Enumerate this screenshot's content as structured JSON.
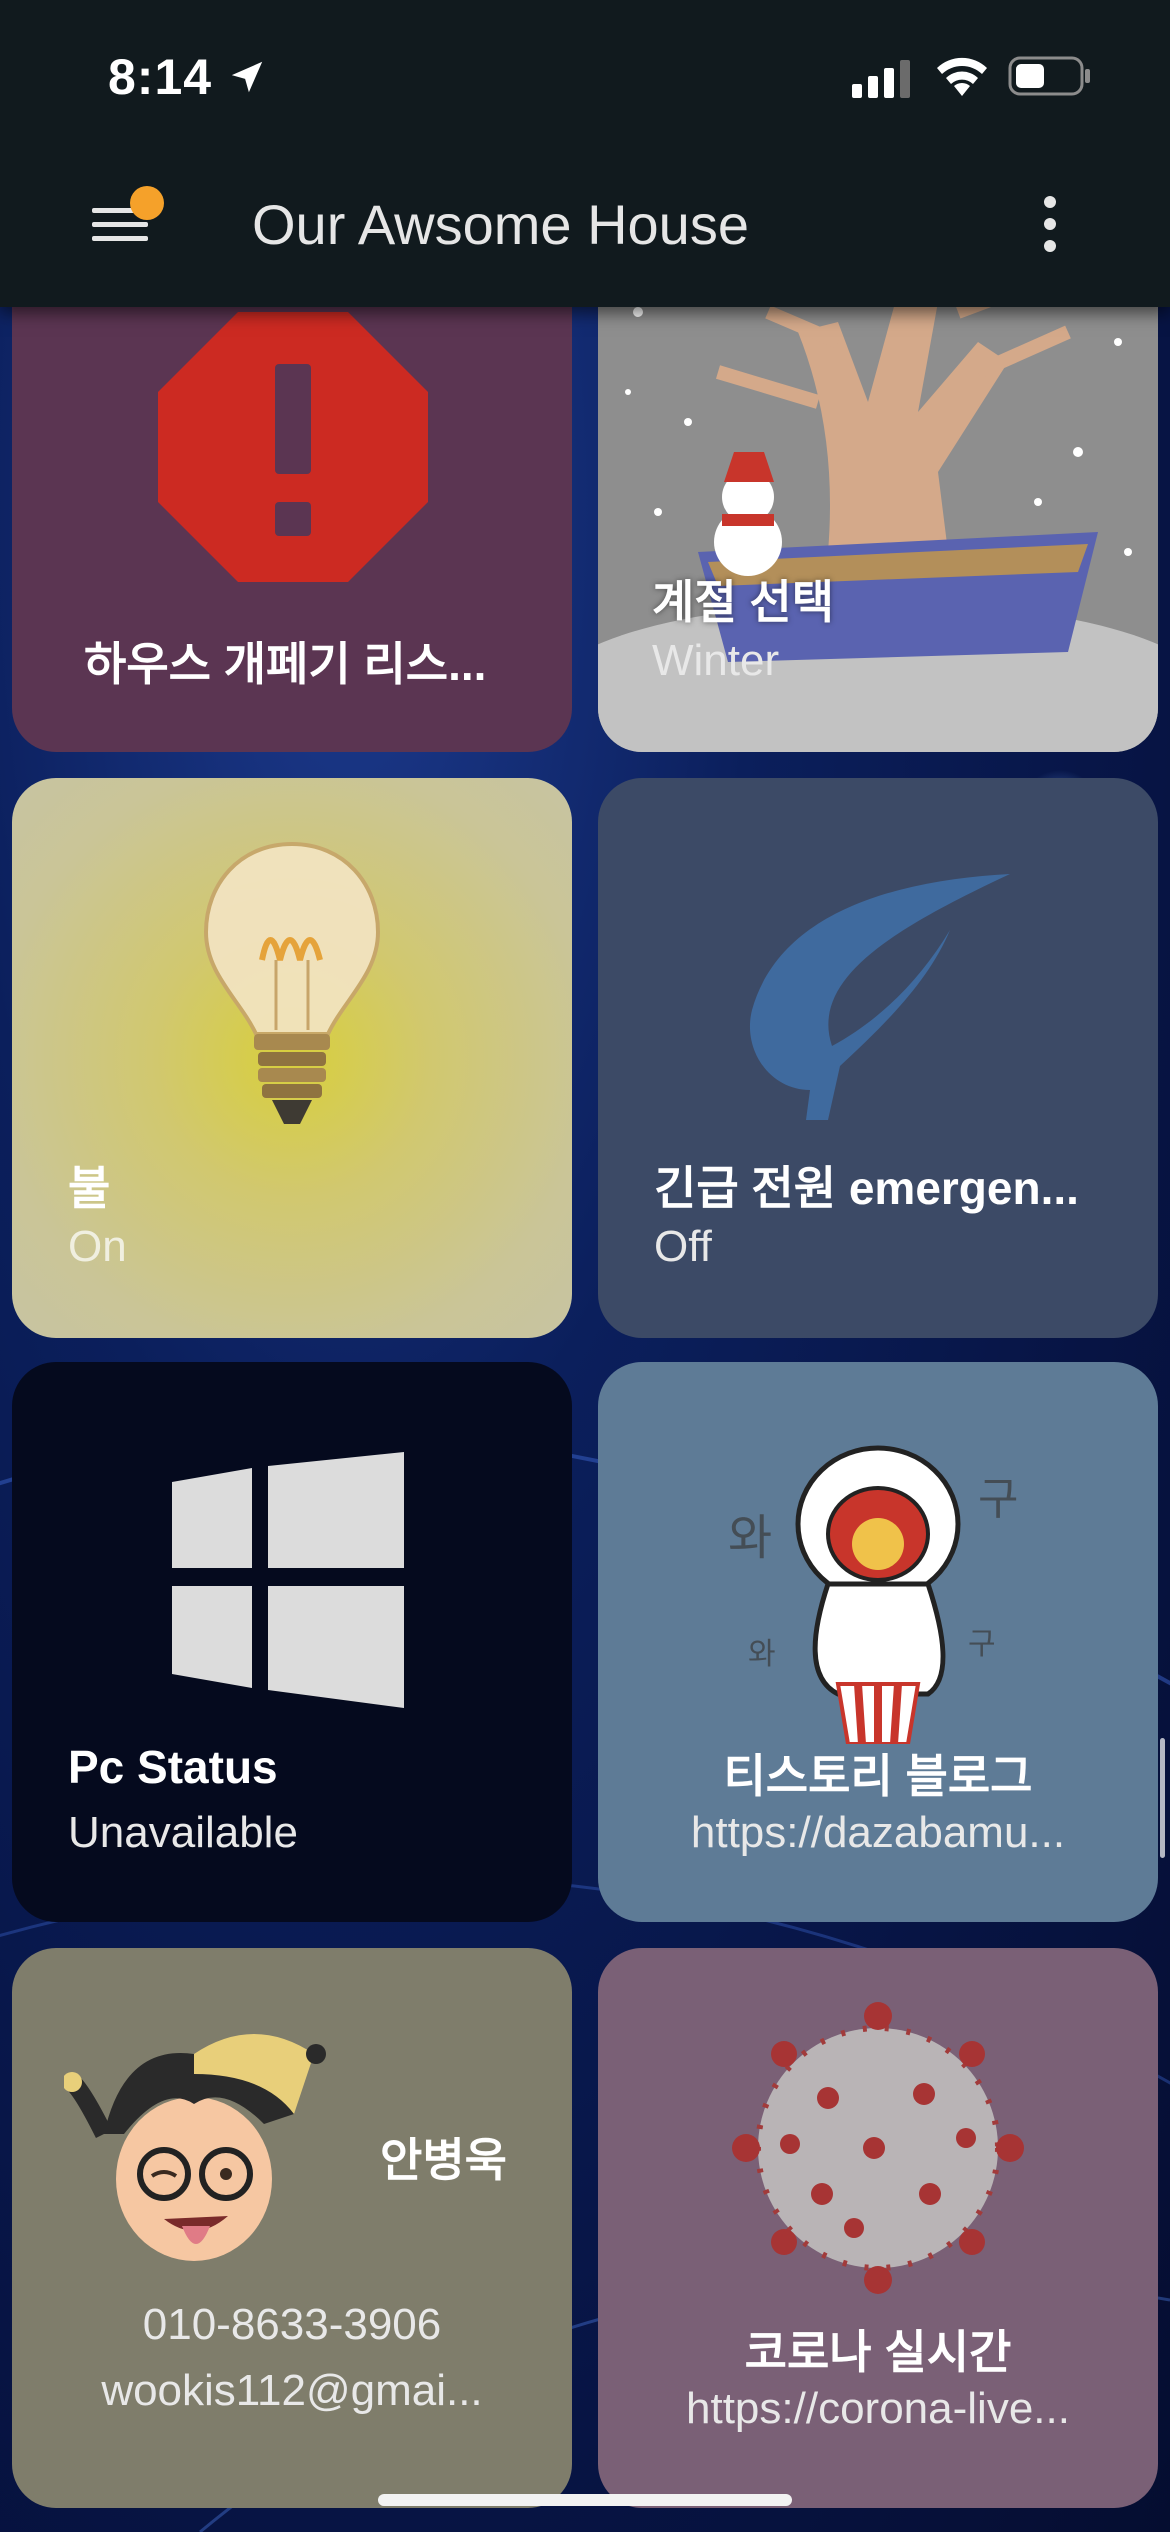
{
  "status_bar": {
    "time": "8:14"
  },
  "app_bar": {
    "title": "Our Awsome House"
  },
  "tiles": [
    {
      "name": "하우스 개페기 리스...",
      "state": ""
    },
    {
      "name": "계절 선택",
      "state": "Winter"
    },
    {
      "name": "불",
      "state": "On"
    },
    {
      "name": "긴급 전원 emergen...",
      "state": "Off"
    },
    {
      "name": "Pc Status",
      "state": "Unavailable"
    },
    {
      "name": "티스토리 블로그",
      "state": "https://dazabamu..."
    },
    {
      "name": "안병욱",
      "phone": "010-8633-3906",
      "email": "wookis112@gmai..."
    },
    {
      "name": "코로나 실시간",
      "state": "https://corona-live..."
    }
  ],
  "icons": {
    "tile1": "warning-octagon-icon",
    "tile2": "bonsai-tree-snowman-image",
    "tile3": "light-bulb-image",
    "tile4": "leaf-icon",
    "tile5": "windows-logo-icon",
    "tile6": "popcorn-character-image",
    "tile7": "jester-avatar-image",
    "tile8": "coronavirus-image"
  },
  "colors": {
    "accent_dot": "#f5a12a",
    "warning_red": "#cc2a22",
    "leaf_blue": "#3f6a9e"
  }
}
